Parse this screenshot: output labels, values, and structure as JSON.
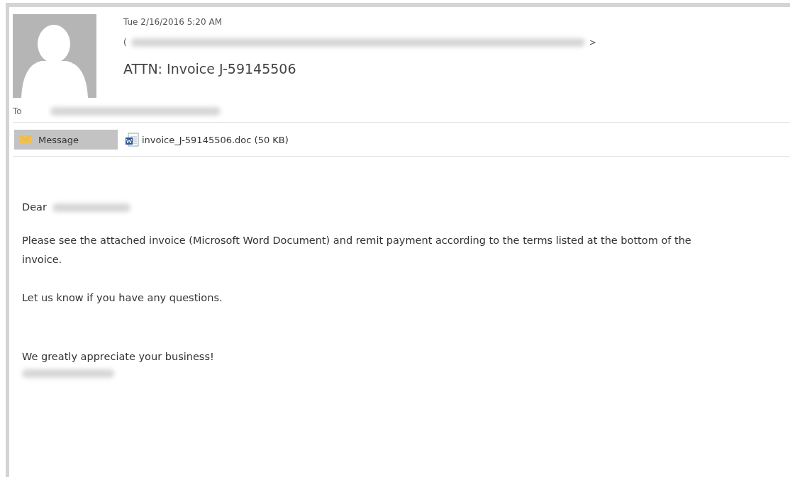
{
  "header": {
    "date": "Tue 2/16/2016 5:20 AM",
    "sender": {
      "open": "(",
      "close": ">",
      "redacted": true
    },
    "subject": "ATTN: Invoice J-59145506",
    "to": {
      "label": "To",
      "redacted": true
    }
  },
  "attachments_bar": {
    "message_tab": {
      "label": "Message",
      "selected": true
    },
    "attachments": [
      {
        "name": "invoice_J-59145506.doc (50 KB)"
      }
    ]
  },
  "body": {
    "greeting": {
      "text": "Dear",
      "name_redacted": true
    },
    "paragraphs": [
      {
        "text": "Please see the attached invoice (Microsoft Word Document) and remit payment according to the terms listed at the bottom of the invoice."
      },
      {
        "text": "Let us know if you have any questions."
      }
    ],
    "closing": "We greatly appreciate your business!",
    "signature_redacted": true
  }
}
